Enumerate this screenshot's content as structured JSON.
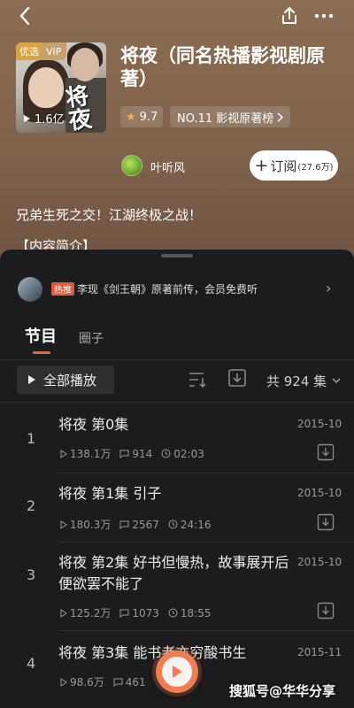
{
  "album": {
    "cover_badge_youxuan": "优选",
    "cover_badge_vip": "VIP",
    "cover_calligraphy": "将夜",
    "cover_playcount": "1.6亿",
    "title": "将夜（同名热播影视剧原著）",
    "score": "9.7",
    "rank": "NO.11 影视原著榜",
    "author": "叶听风",
    "subscribe_label": "订阅",
    "subscribe_count": "(27.6万)",
    "slogan": "兄弟生死之交！江湖终极之战！",
    "intro_heading": "【内容简介】"
  },
  "promo": {
    "tag": "热推",
    "text": "李现《剑王朝》原著前传，会员免费听"
  },
  "tabs": [
    {
      "label": "节目",
      "active": true
    },
    {
      "label": "圈子",
      "active": false
    }
  ],
  "toolbar": {
    "play_all": "全部播放",
    "total": "共 924 集"
  },
  "episodes": [
    {
      "num": "1",
      "title": "将夜 第0集",
      "date": "2015-10",
      "plays": "138.1万",
      "comments": "914",
      "duration": "02:03"
    },
    {
      "num": "2",
      "title": "将夜 第1集 引子",
      "date": "2015-10",
      "plays": "180.3万",
      "comments": "2567",
      "duration": "24:16"
    },
    {
      "num": "3",
      "title": "将夜 第2集 好书但慢热，故事展开后便欲罢不能了",
      "date": "2015-10",
      "plays": "125.2万",
      "comments": "1073",
      "duration": "18:55"
    },
    {
      "num": "4",
      "title": "将夜 第3集 能书者亦穷酸书生",
      "date": "2015-11",
      "plays": "98.6万",
      "comments": "461",
      "duration": ""
    }
  ],
  "watermark": "搜狐号@华华分享",
  "colors": {
    "hero_bg": "#8b6d52",
    "sheet_bg": "#1c1c1e",
    "accent": "#e8643c",
    "fab": "#ee7f53",
    "star": "#f2b23a"
  }
}
